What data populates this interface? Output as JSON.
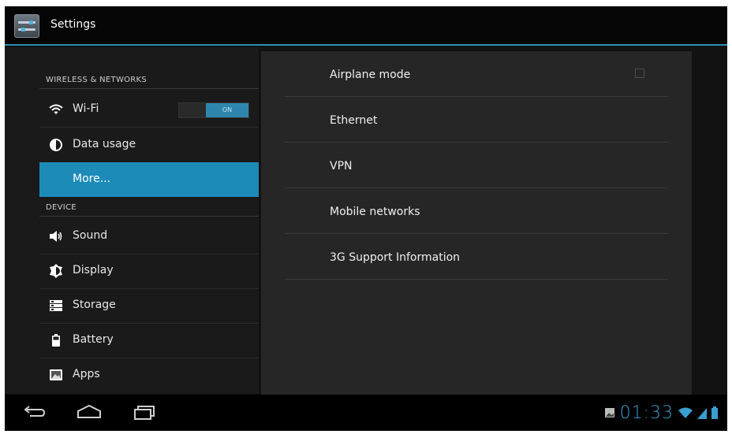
{
  "actionbar": {
    "title": "Settings",
    "icon": "settings-sliders-icon"
  },
  "left_pane": {
    "sections": [
      {
        "header": "WIRELESS & NETWORKS",
        "items": [
          {
            "label": "Wi-Fi",
            "icon": "wifi-icon",
            "toggle": "ON"
          },
          {
            "label": "Data usage",
            "icon": "data-usage-icon"
          },
          {
            "label": "More...",
            "icon": "",
            "selected": true
          }
        ]
      },
      {
        "header": "DEVICE",
        "items": [
          {
            "label": "Sound",
            "icon": "speaker-icon"
          },
          {
            "label": "Display",
            "icon": "display-brightness-icon"
          },
          {
            "label": "Storage",
            "icon": "storage-icon"
          },
          {
            "label": "Battery",
            "icon": "battery-icon"
          },
          {
            "label": "Apps",
            "icon": "apps-icon"
          }
        ]
      }
    ]
  },
  "right_pane": {
    "items": [
      {
        "label": "Airplane mode",
        "checkbox": false
      },
      {
        "label": "Ethernet"
      },
      {
        "label": "VPN"
      },
      {
        "label": "Mobile networks"
      },
      {
        "label": "3G Support Information"
      }
    ]
  },
  "navbar": {
    "buttons": [
      "back-icon",
      "home-icon",
      "recent-apps-icon"
    ],
    "status": {
      "time": "01:33",
      "icons": [
        "gallery-notification-icon",
        "wifi-signal-icon",
        "cell-signal-icon",
        "battery-status-icon"
      ]
    }
  },
  "colors": {
    "accent": "#1d8bb8",
    "clock": "#3b9ed0",
    "background": "#121212"
  }
}
